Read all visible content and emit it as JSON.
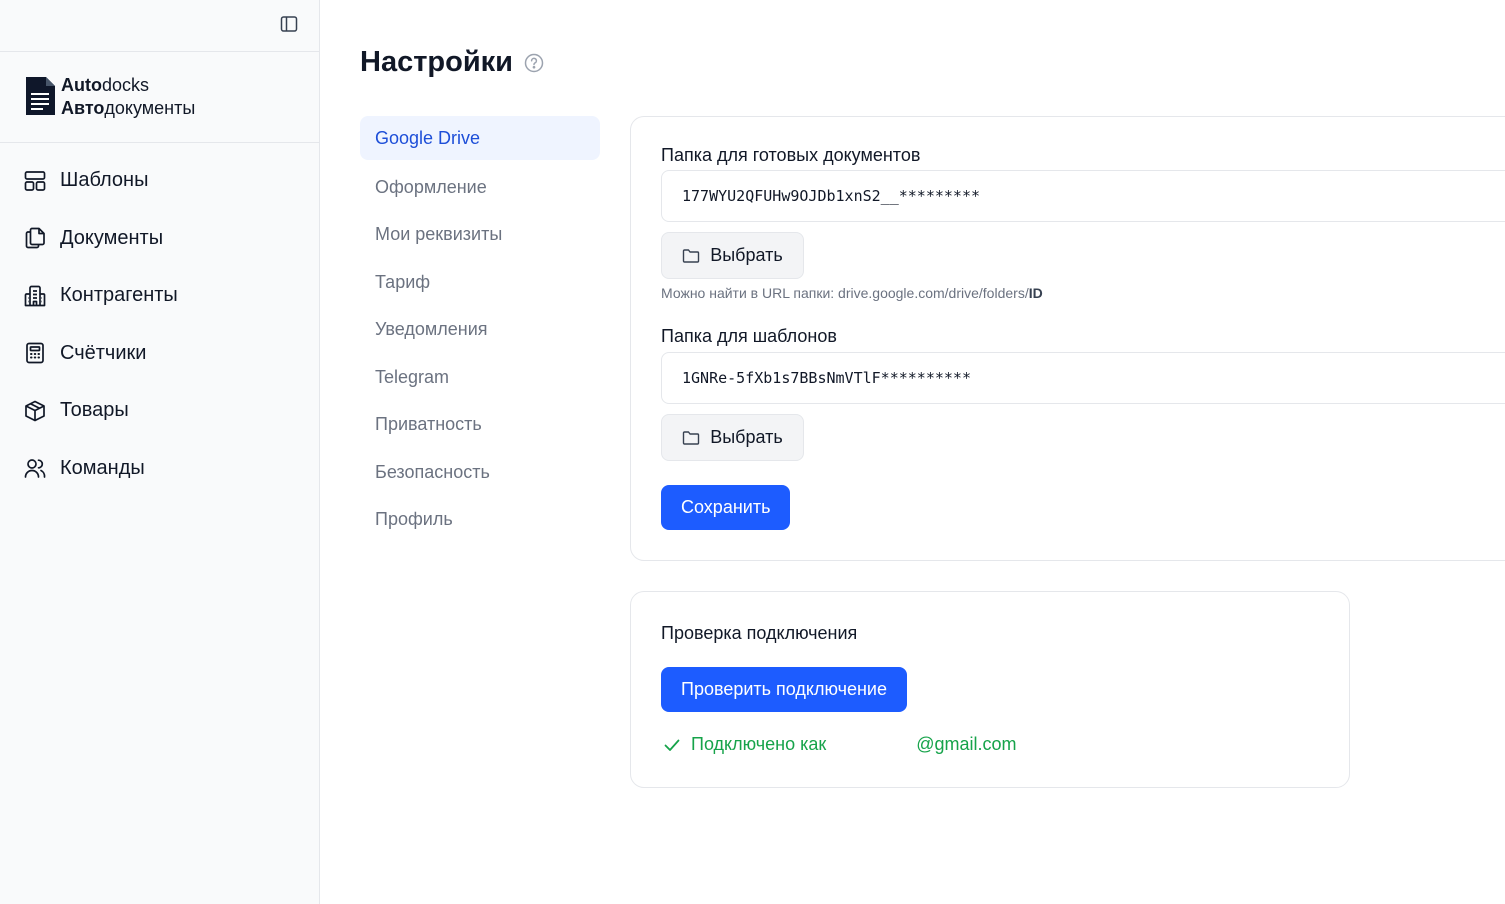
{
  "brand": {
    "line1_bold": "Auto",
    "line1_rest": "docks",
    "line2_bold": "Авто",
    "line2_rest": "документы"
  },
  "sidebar": {
    "items": [
      {
        "label": "Шаблоны",
        "icon": "layout-icon"
      },
      {
        "label": "Документы",
        "icon": "documents-icon"
      },
      {
        "label": "Контрагенты",
        "icon": "building-icon"
      },
      {
        "label": "Счётчики",
        "icon": "calculator-icon"
      },
      {
        "label": "Товары",
        "icon": "box-icon"
      },
      {
        "label": "Команды",
        "icon": "users-icon"
      }
    ]
  },
  "page": {
    "title": "Настройки"
  },
  "settings_nav": {
    "items": [
      "Google Drive",
      "Оформление",
      "Мои реквизиты",
      "Тариф",
      "Уведомления",
      "Telegram",
      "Приватность",
      "Безопасность",
      "Профиль"
    ],
    "active": "Google Drive"
  },
  "drive": {
    "docs_folder_label": "Папка для готовых документов",
    "docs_folder_value": "177WYU2QFUHw9OJDb1xnS2__*********",
    "choose_label": "Выбрать",
    "hint_prefix": "Можно найти в URL папки: drive.google.com/drive/folders/",
    "hint_bold": "ID",
    "templates_folder_label": "Папка для шаблонов",
    "templates_folder_value": "1GNRe-5fXb1s7BBsNmVTlF**********",
    "save_label": "Сохранить"
  },
  "check": {
    "title": "Проверка подключения",
    "button_label": "Проверить подключение",
    "status_prefix": "Подключено как",
    "status_email_suffix": "@gmail.com"
  },
  "colors": {
    "primary": "#1d5cff",
    "active_nav_bg": "#eff4ff",
    "active_nav_text": "#1d4ed8",
    "success": "#16a34a"
  }
}
